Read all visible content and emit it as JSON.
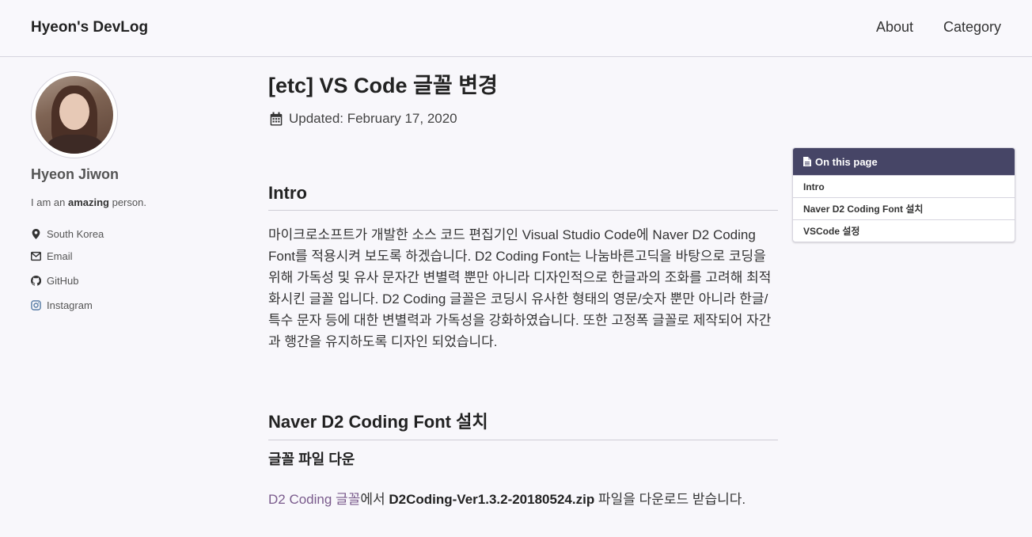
{
  "header": {
    "site_title": "Hyeon's DevLog",
    "nav": [
      "About",
      "Category"
    ]
  },
  "sidebar": {
    "author_name": "Hyeon Jiwon",
    "bio_prefix": "I am an ",
    "bio_bold": "amazing",
    "bio_suffix": " person.",
    "links": [
      {
        "label": "South Korea",
        "icon": "map-marker-icon"
      },
      {
        "label": "Email",
        "icon": "envelope-icon"
      },
      {
        "label": "GitHub",
        "icon": "github-icon"
      },
      {
        "label": "Instagram",
        "icon": "instagram-icon"
      }
    ]
  },
  "post": {
    "title": "[etc] VS Code 글꼴 변경",
    "updated": "Updated: February 17, 2020",
    "sections": [
      {
        "heading": "Intro",
        "text": "마이크로소프트가 개발한 소스 코드 편집기인 Visual Studio Code에 Naver D2 Coding Font를 적용시켜 보도록 하겠습니다. D2 Coding Font는 나눔바른고딕을 바탕으로 코딩을 위해 가독성 및 유사 문자간 변별력 뿐만 아니라 디자인적으로 한글과의 조화를 고려해 최적화시킨 글꼴 입니다. D2 Coding 글꼴은 코딩시 유사한 형태의 영문/숫자 뿐만 아니라 한글/특수 문자 등에 대한 변별력과 가독성을 강화하였습니다. 또한 고정폭 글꼴로 제작되어 자간과 행간을 유지하도록 디자인 되었습니다."
      },
      {
        "heading": "Naver D2 Coding Font 설치",
        "subheading": "글꼴 파일 다운",
        "link_text": "D2 Coding 글꼴",
        "text_mid": "에서 ",
        "bold_text": "D2Coding-Ver1.3.2-20180524.zip",
        "text_end": " 파일을 다운로드 받습니다."
      }
    ]
  },
  "toc": {
    "title": "On this page",
    "items": [
      "Intro",
      "Naver D2 Coding Font 설치",
      "VSCode 설정"
    ]
  },
  "colors": {
    "toc_header": "#464566",
    "link": "#7a5b8c",
    "background": "#f8f7fb"
  }
}
